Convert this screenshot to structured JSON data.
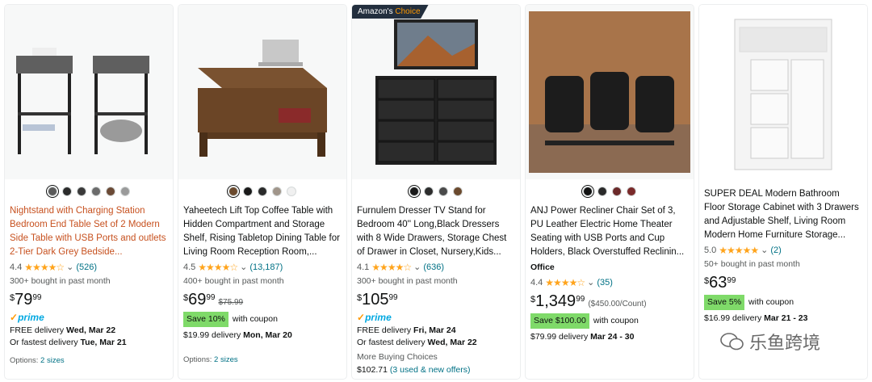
{
  "cards": [
    {
      "title": "Nightstand with Charging Station Bedroom End Table Set of 2 Modern Side Table with USB Ports and outlets 2-Tier Dark Grey Bedside...",
      "swatches": [
        "#5a5a5a",
        "#2b2b2b",
        "#3a3a3a",
        "#6b6b6b",
        "#6b4a36",
        "#9a9a9a"
      ],
      "rating": "4.4",
      "stars": "★★★★☆",
      "reviews": "(526)",
      "bought": "300+ bought in past month",
      "price_sym": "$",
      "price_whole": "79",
      "price_frac": "99",
      "prime": "prime",
      "delivery_1": "FREE delivery",
      "delivery_1_date": "Wed, Mar 22",
      "delivery_2": "Or fastest delivery",
      "delivery_2_date": "Tue, Mar 21",
      "options_label": "Options:",
      "options_link": "2 sizes"
    },
    {
      "title": "Yaheetech Lift Top Coffee Table with Hidden Compartment and Storage Shelf, Rising Tabletop Dining Table for Living Room Reception Room,...",
      "swatches": [
        "#6b4a2e",
        "#1a1a1a",
        "#2a2a2a",
        "#a0958a",
        "#f0f0f0"
      ],
      "rating": "4.5",
      "stars": "★★★★☆",
      "reviews": "(13,187)",
      "bought": "400+ bought in past month",
      "price_sym": "$",
      "price_whole": "69",
      "price_frac": "99",
      "list_price": "$75.99",
      "save_tag": "Save 10%",
      "save_text": "with coupon",
      "delivery_1": "$19.99 delivery",
      "delivery_1_date": "Mon, Mar 20",
      "options_label": "Options:",
      "options_link": "2 sizes"
    },
    {
      "badge_left": "Amazon's",
      "badge_right": "Choice",
      "title": "Furnulem Dresser TV Stand for Bedroom 40'' Long,Black Dressers with 8 Wide Drawers, Storage Chest of Drawer in Closet, Nursery,Kids...",
      "swatches": [
        "#1a1a1a",
        "#2d2d2d",
        "#4a4a4a",
        "#6b4a2e"
      ],
      "rating": "4.1",
      "stars": "★★★★☆",
      "reviews": "(636)",
      "bought": "300+ bought in past month",
      "price_sym": "$",
      "price_whole": "105",
      "price_frac": "99",
      "prime": "prime",
      "delivery_1": "FREE delivery",
      "delivery_1_date": "Fri, Mar 24",
      "delivery_2": "Or fastest delivery",
      "delivery_2_date": "Wed, Mar 22",
      "more_buying": "More Buying Choices",
      "more_price": "$102.71",
      "more_link": "(3 used & new offers)"
    },
    {
      "title": "ANJ Power Recliner Chair Set of 3, PU Leather Electric Home Theater Seating with USB Ports and Cup Holders, Black Overstuffed Reclinin...",
      "swatches": [
        "#111111",
        "#2a2a2a",
        "#6b2a2a",
        "#7a2a2a"
      ],
      "office": "Office",
      "rating": "4.4",
      "stars": "★★★★☆",
      "reviews": "(35)",
      "price_sym": "$",
      "price_whole": "1,349",
      "price_frac": "99",
      "per_count": "($450.00/Count)",
      "save_tag": "Save $100.00",
      "save_text": "with coupon",
      "delivery_1": "$79.99 delivery",
      "delivery_1_date": "Mar 24 - 30"
    },
    {
      "title": "SUPER DEAL Modern Bathroom Floor Storage Cabinet with 3 Drawers and Adjustable Shelf, Living Room Modern Home Furniture Storage...",
      "rating": "5.0",
      "stars": "★★★★★",
      "reviews": "(2)",
      "bought": "50+ bought in past month",
      "price_sym": "$",
      "price_whole": "63",
      "price_frac": "99",
      "save_tag": "Save 5%",
      "save_text": "with coupon",
      "delivery_1": "$16.99 delivery",
      "delivery_1_date": "Mar 21 - 23"
    }
  ],
  "watermark": "乐鱼跨境"
}
